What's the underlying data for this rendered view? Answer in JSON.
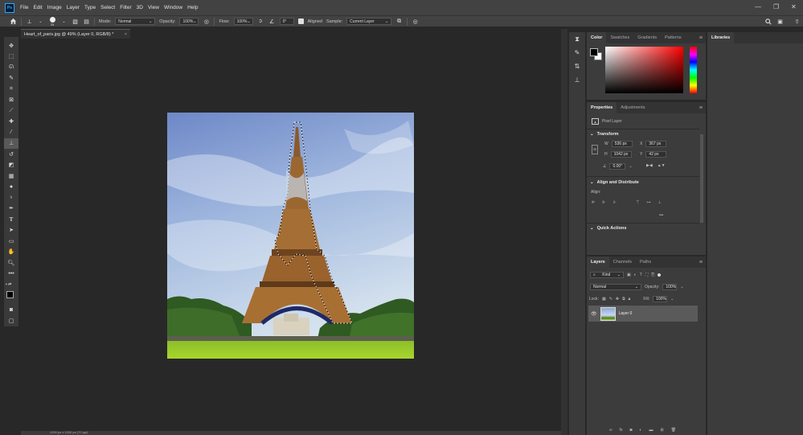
{
  "app": {
    "logo": "Ps"
  },
  "menu": [
    "File",
    "Edit",
    "Image",
    "Layer",
    "Type",
    "Select",
    "Filter",
    "3D",
    "View",
    "Window",
    "Help"
  ],
  "options_bar": {
    "brush_size": "25",
    "mode_label": "Mode:",
    "mode_value": "Normal",
    "opacity_label": "Opacity:",
    "opacity_value": "100%",
    "flow_label": "Flow:",
    "flow_value": "100%",
    "angle_value": "0°",
    "aligned_label": "Aligned",
    "sample_label": "Sample:",
    "sample_value": "Current Layer"
  },
  "document": {
    "tab_title": "Heart_of_paris.jpg @ 49% (Layer 0, RGB/8) *",
    "tab_close": "×"
  },
  "color_panel": {
    "tabs": [
      "Color",
      "Swatches",
      "Gradients",
      "Patterns"
    ],
    "active_tab": "Color",
    "hue_color": "#ff0000"
  },
  "libraries_panel": {
    "tab": "Libraries"
  },
  "properties_panel": {
    "tabs": [
      "Properties",
      "Adjustments"
    ],
    "layer_type": "Pixel Layer",
    "transform_title": "Transform",
    "w_label": "W",
    "w_value": "536 px",
    "h_label": "H",
    "h_value": "1042 px",
    "x_label": "X",
    "x_value": "367 px",
    "y_label": "Y",
    "y_value": "42 px",
    "angle_value": "0.00°",
    "align_title": "Align and Distribute",
    "align_label": "Align:",
    "more": "•••",
    "quick_actions_title": "Quick Actions"
  },
  "layers_panel": {
    "tabs": [
      "Layers",
      "Channels",
      "Paths"
    ],
    "filter_kind": "Kind",
    "blend_mode": "Normal",
    "opacity_label": "Opacity:",
    "opacity_value": "100%",
    "lock_label": "Lock:",
    "fill_label": "Fill:",
    "fill_value": "100%",
    "layers": [
      {
        "name": "Layer 0",
        "visible": true,
        "selected": true
      }
    ],
    "footer_fx": "fx"
  },
  "status_bar": {
    "text": "1200 px x 1200 px (72 ppi)"
  },
  "colors": {
    "accent": "#31a8ff",
    "ui_bg": "#3c3c3c",
    "canvas_bg": "#282828"
  }
}
